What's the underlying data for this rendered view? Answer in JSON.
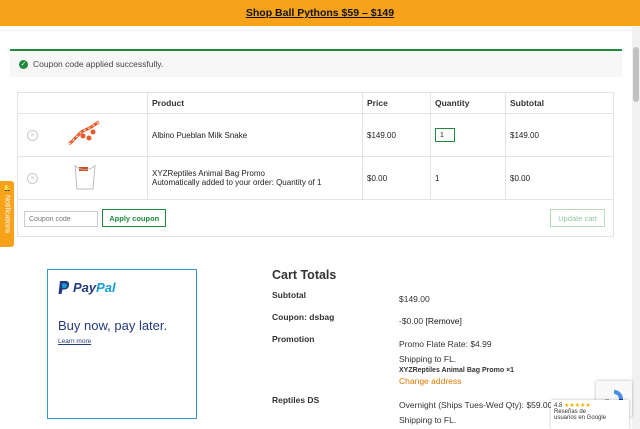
{
  "topbar": {
    "link": "Shop Ball Pythons $59 – $149"
  },
  "notice": {
    "message": "Coupon code applied successfully."
  },
  "cart": {
    "headers": {
      "product": "Product",
      "price": "Price",
      "quantity": "Quantity",
      "subtotal": "Subtotal"
    },
    "rows": [
      {
        "name": "Albino Pueblan Milk Snake",
        "price": "$149.00",
        "quantity": "1",
        "subtotal": "$149.00"
      },
      {
        "name": "XYZReptiles Animal Bag Promo",
        "note": "Automatically added to your order: Quantity of 1",
        "price": "$0.00",
        "quantity": "1",
        "subtotal": "$0.00"
      }
    ],
    "coupon_placeholder": "Coupon code",
    "apply_label": "Apply coupon",
    "update_label": "Update cart"
  },
  "notifications": {
    "label": "Notifications"
  },
  "paypal": {
    "brand_pay": "Pay",
    "brand_pal": "Pal",
    "tagline": "Buy now, pay later.",
    "learn_more": "Learn more"
  },
  "totals": {
    "title": "Cart Totals",
    "subtotal_label": "Subtotal",
    "subtotal_value": "$149.00",
    "coupon_label": "Coupon: dsbag",
    "coupon_value": "-$0.00",
    "coupon_remove": "[Remove]",
    "promotion_label": "Promotion",
    "promotion_rate": "Promo Flate Rate: $4.99",
    "promotion_shipping": "Shipping to FL.",
    "promotion_item": "XYZReptiles Animal Bag Promo ×1",
    "change_address": "Change address",
    "reptiles_label": "Reptiles DS",
    "reptiles_rate": "Overnight (Ships Tues-Wed Qty): $59.00",
    "reptiles_shipping": "Shipping to FL."
  },
  "google_badge": {
    "rating": "4.8",
    "stars": "★★★★★",
    "line1": "Reseñas de",
    "line2": "usuarios en Google"
  },
  "colors": {
    "accent": "#f7a21b",
    "success": "#1e8a3c",
    "paypal_blue": "#253b80",
    "paypal_light": "#179bd7"
  }
}
